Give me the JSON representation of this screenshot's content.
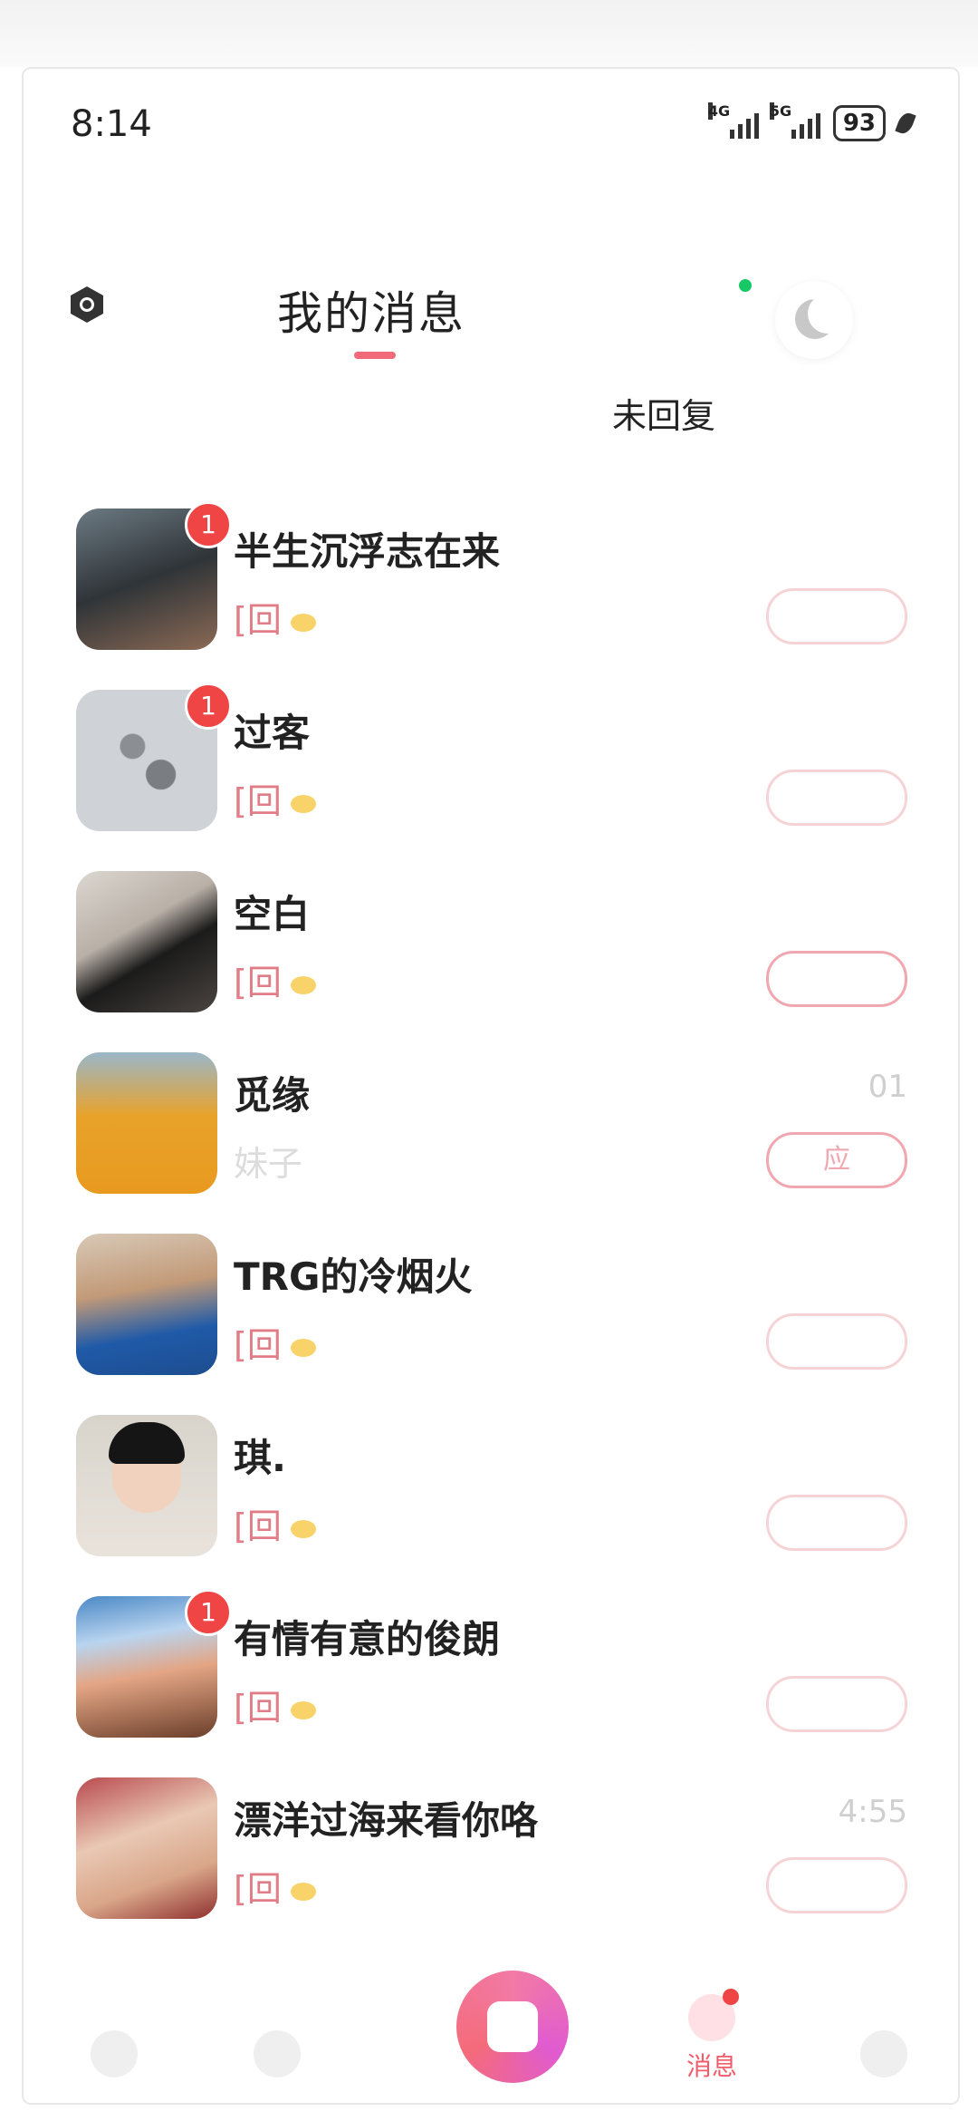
{
  "status_bar": {
    "time": "8:14",
    "network1": "4G",
    "network2": "5G",
    "battery": "93"
  },
  "header": {
    "title": "我的消息"
  },
  "filters": {
    "unreplied": "未回复"
  },
  "conversations": [
    {
      "name": "半生沉浮志在来",
      "badge": "1",
      "preview_prefix": "[回",
      "time": "",
      "reply_label": ""
    },
    {
      "name": "过客",
      "badge": "1",
      "preview_prefix": "[回",
      "time": "",
      "reply_label": ""
    },
    {
      "name": "空白",
      "badge": "",
      "preview_prefix": "[回",
      "time": "",
      "reply_label": ""
    },
    {
      "name": "觅缘",
      "badge": "",
      "preview_prefix": "",
      "preview_text": "妹子",
      "time": "01",
      "reply_label": "应"
    },
    {
      "name": "TRG的冷烟火",
      "badge": "",
      "preview_prefix": "[回",
      "time": "",
      "reply_label": ""
    },
    {
      "name": "琪.",
      "badge": "",
      "preview_prefix": "[回",
      "time": "",
      "reply_label": ""
    },
    {
      "name": "有情有意的俊朗",
      "badge": "1",
      "preview_prefix": "[回",
      "time": "",
      "reply_label": ""
    },
    {
      "name": "漂洋过海来看你咯",
      "badge": "",
      "preview_prefix": "[回",
      "time": "4:55",
      "reply_label": ""
    }
  ],
  "bottom_nav": {
    "messages_label": "消息"
  },
  "colors": {
    "accent": "#f06a78",
    "badge": "#f04545",
    "online_dot": "#17c964"
  }
}
